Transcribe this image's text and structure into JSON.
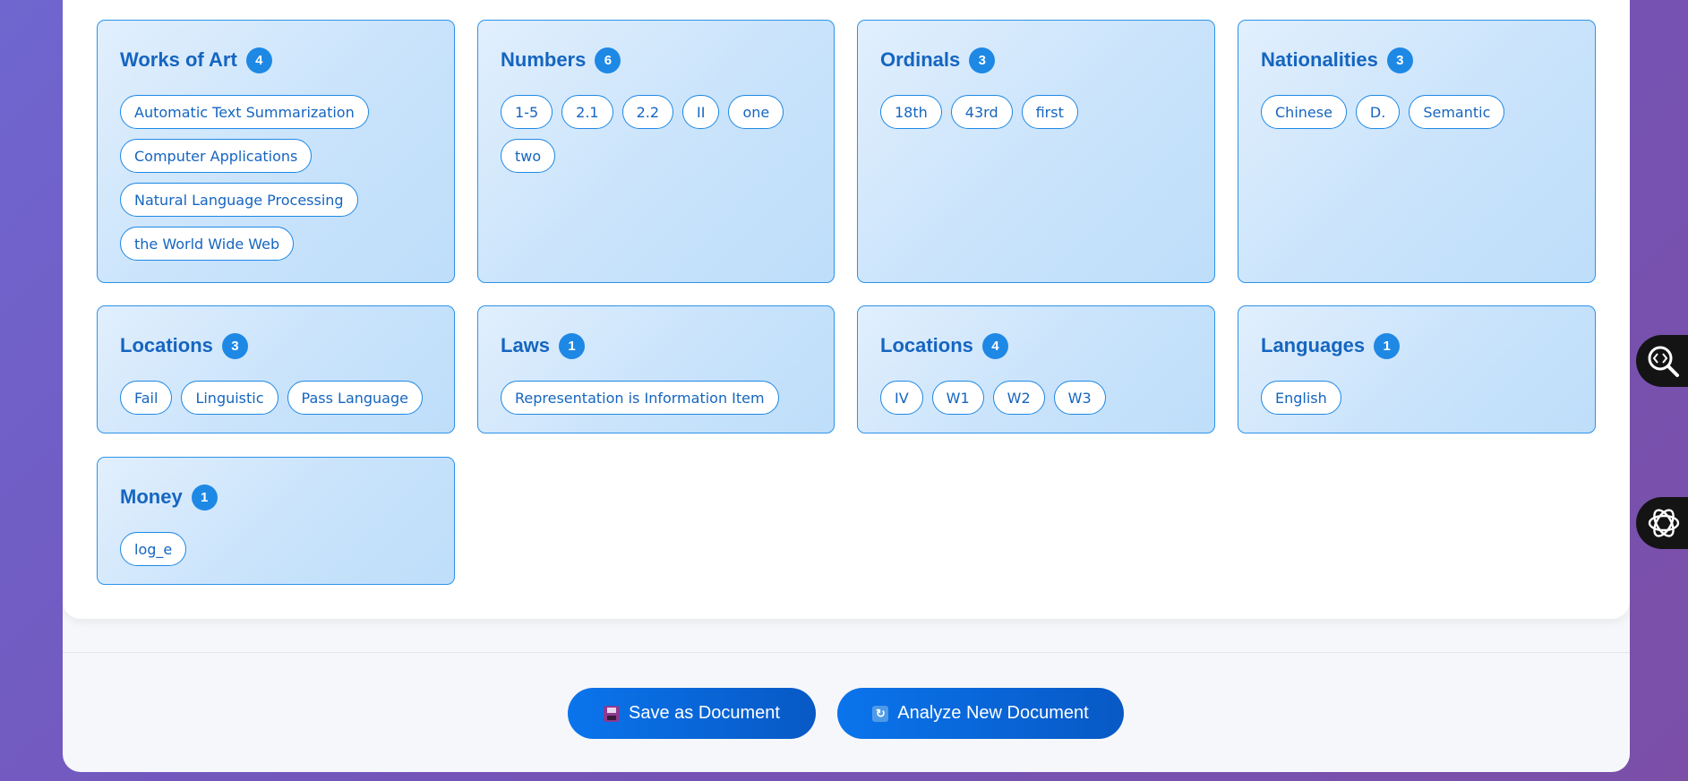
{
  "cards": [
    {
      "title": "Works of Art",
      "count": "4",
      "tags": [
        "Automatic Text Summarization",
        "Computer Applications",
        "Natural Language Processing",
        "the World Wide Web"
      ]
    },
    {
      "title": "Numbers",
      "count": "6",
      "tags": [
        "1-5",
        "2.1",
        "2.2",
        "II",
        "one",
        "two"
      ]
    },
    {
      "title": "Ordinals",
      "count": "3",
      "tags": [
        "18th",
        "43rd",
        "first"
      ]
    },
    {
      "title": "Nationalities",
      "count": "3",
      "tags": [
        "Chinese",
        "D.",
        "Semantic"
      ]
    },
    {
      "title": "Locations",
      "count": "3",
      "tags": [
        "Fail",
        "Linguistic",
        "Pass Language"
      ]
    },
    {
      "title": "Laws",
      "count": "1",
      "tags": [
        "Representation is Information Item"
      ]
    },
    {
      "title": "Locations",
      "count": "4",
      "tags": [
        "IV",
        "W1",
        "W2",
        "W3"
      ]
    },
    {
      "title": "Languages",
      "count": "1",
      "tags": [
        "English"
      ]
    },
    {
      "title": "Money",
      "count": "1",
      "tags": [
        "log_e"
      ]
    }
  ],
  "actions": {
    "save_label": "Save as Document",
    "save_icon": "floppy-disk-icon",
    "analyze_label": "Analyze New Document",
    "analyze_icon": "refresh-icon"
  },
  "side_widgets": {
    "top_icon": "code-search-icon",
    "bottom_icon": "openai-logo-icon"
  },
  "colors": {
    "accent": "#1e88e5",
    "title": "#1565c0",
    "button": "#0a6de0"
  }
}
